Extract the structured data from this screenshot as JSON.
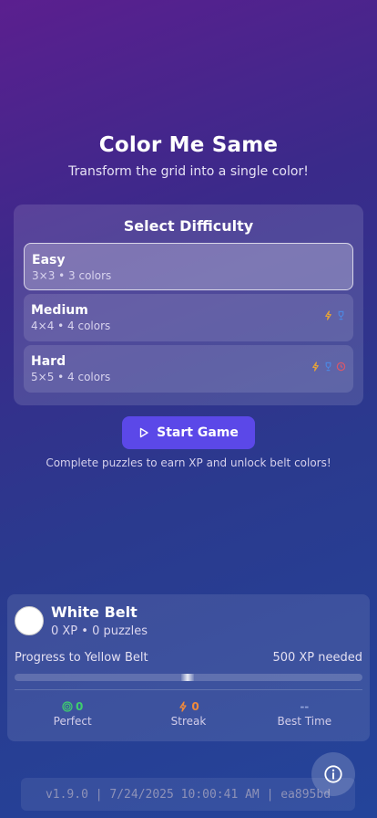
{
  "header": {
    "title": "Color Me Same",
    "subtitle": "Transform the grid into a single color!"
  },
  "difficulty": {
    "heading": "Select Difficulty",
    "options": [
      {
        "name": "Easy",
        "description": "3×3 • 3 colors",
        "selected": true,
        "icons": []
      },
      {
        "name": "Medium",
        "description": "4×4 • 4 colors",
        "selected": false,
        "icons": [
          "lightning-icon",
          "trophy-icon"
        ]
      },
      {
        "name": "Hard",
        "description": "5×5 • 4 colors",
        "selected": false,
        "icons": [
          "lightning-icon",
          "trophy-icon",
          "clock-icon"
        ]
      }
    ]
  },
  "start_button": {
    "label": "Start Game",
    "icon": "play-icon"
  },
  "hint": "Complete puzzles to earn XP and unlock belt colors!",
  "belt": {
    "name": "White Belt",
    "stats": "0 XP • 0 puzzles",
    "progress_label": "Progress to Yellow Belt",
    "xp_needed": "500 XP needed",
    "progress_fraction": 0,
    "avatar_color": "#ffffff"
  },
  "stats": [
    {
      "value": "0",
      "label": "Perfect",
      "icon": "target-icon",
      "color": "#3ecf6e"
    },
    {
      "value": "0",
      "label": "Streak",
      "icon": "lightning-icon",
      "color": "#f08a3c"
    },
    {
      "value": "--",
      "label": "Best Time",
      "icon": "",
      "color": "#8fa0d8"
    }
  ],
  "version": "v1.9.0 | 7/24/2025 10:00:41 AM | ea895bd",
  "info_button": {
    "icon": "info-icon"
  },
  "colors": {
    "accent": "#5b48e8",
    "lightning": "#e3a23a",
    "trophy": "#4d86e0",
    "clock": "#d9576a"
  }
}
